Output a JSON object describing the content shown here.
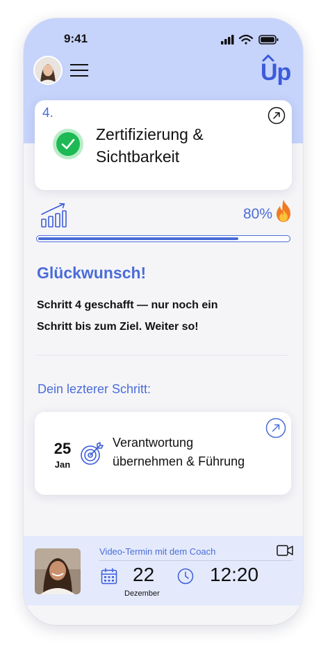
{
  "status_bar": {
    "time": "9:41"
  },
  "header": {
    "avatar": "user-avatar",
    "logo_text": "Up"
  },
  "current_step": {
    "number": "4.",
    "title_line1": "Zertifizierung &",
    "title_line2": "Sichtbarkeit",
    "icon": "check-circle-icon"
  },
  "progress": {
    "label": "80%",
    "value": 80
  },
  "congrats": {
    "title": "Glückwunsch!",
    "message_line1": "Schritt 4 geschafft — nur noch ein",
    "message_line2": "Schritt bis zum Ziel. Weiter so!"
  },
  "last_step": {
    "label": "Dein lezterer Schritt:",
    "day": "25",
    "month": "Jan",
    "title_line1": "Verantwortung",
    "title_line2": "übernehmen & Führung",
    "icon": "target-icon"
  },
  "coach": {
    "label": "Video-Termin mit dem Coach",
    "day": "22",
    "month": "Dezember",
    "time": "12:20"
  },
  "colors": {
    "accent": "#4a6cd8",
    "hero_bg": "#c6d3fb",
    "coach_bg": "#e4eafc",
    "success": "#1db954"
  }
}
